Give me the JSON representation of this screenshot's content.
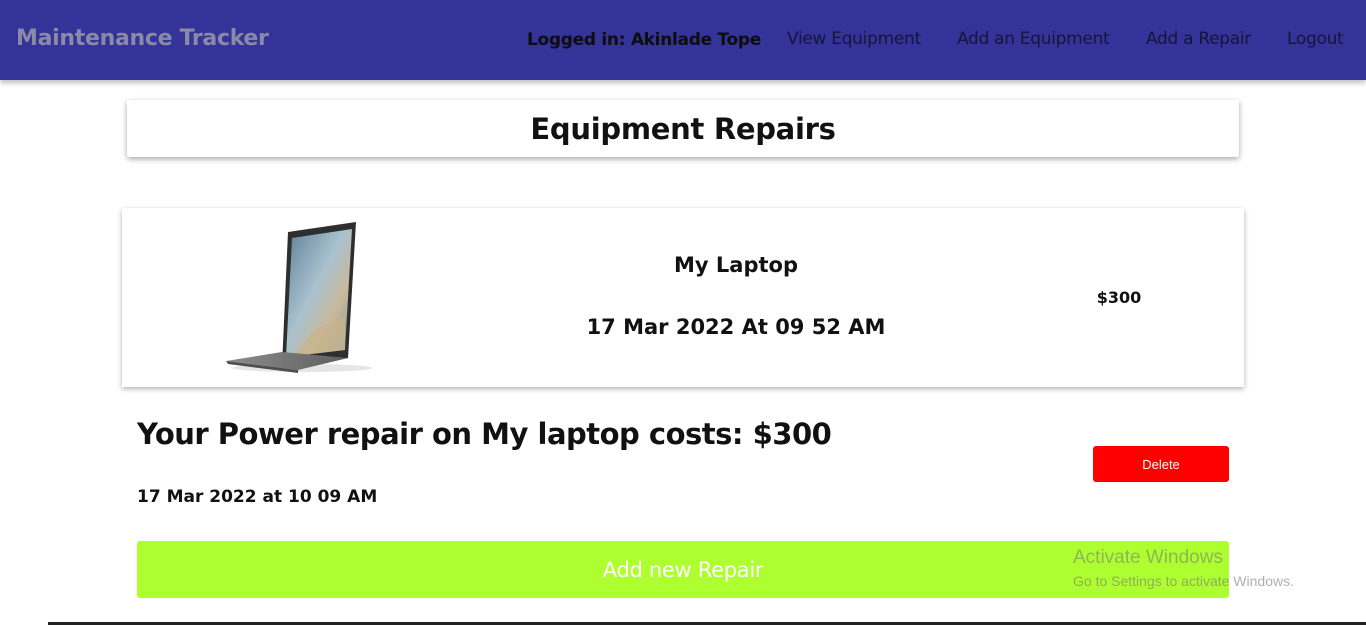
{
  "navbar": {
    "brand": "Maintenance Tracker",
    "user": "Logged in: Akinlade Tope",
    "links": [
      "View Equipment",
      "Add an Equipment",
      "Add a Repair",
      "Logout"
    ]
  },
  "page": {
    "title": "Equipment Repairs"
  },
  "equipment": {
    "name": "My Laptop",
    "date": "17 Mar 2022 At 09 52 AM",
    "cost": "$300"
  },
  "repair": {
    "summary": "Your Power repair on My laptop costs: $300",
    "date": "17 Mar 2022 at 10 09 AM",
    "delete_label": "Delete"
  },
  "actions": {
    "add_repair_label": "Add new Repair"
  },
  "watermark": {
    "title": "Activate Windows",
    "subtitle": "Go to Settings to activate Windows."
  },
  "colors": {
    "navbar": "#33339a",
    "delete": "#ff0000",
    "add_repair": "#adff2f"
  }
}
